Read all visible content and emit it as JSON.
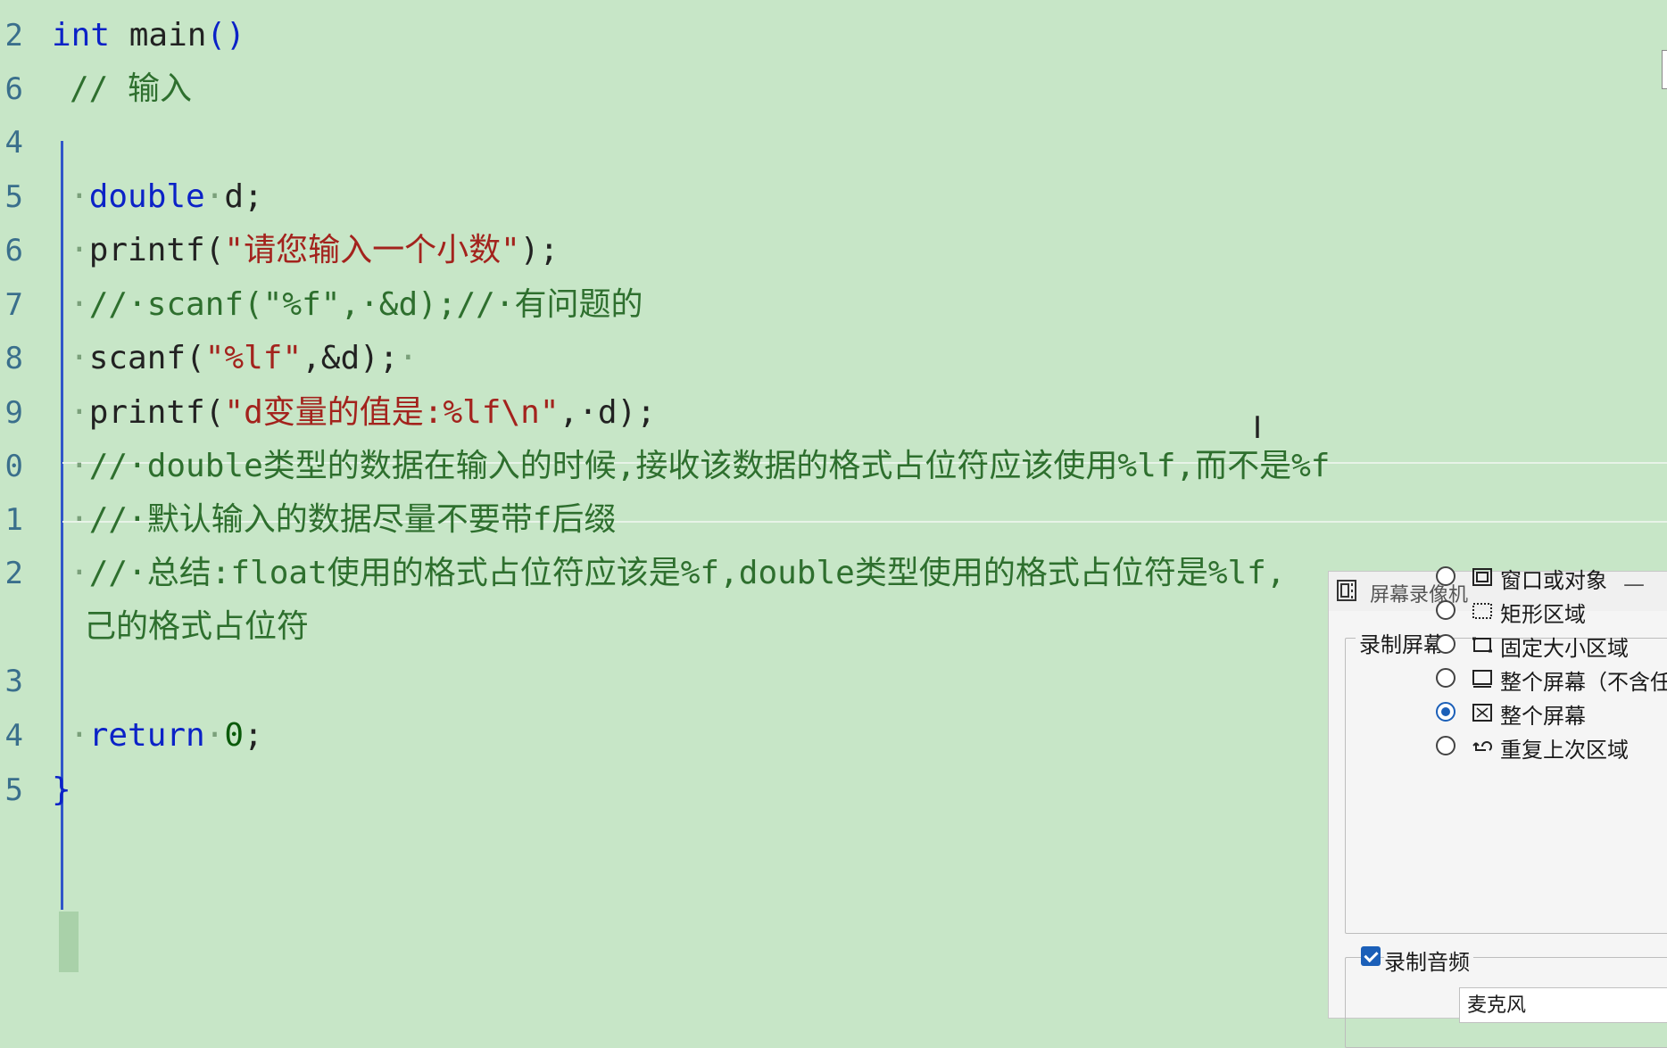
{
  "editor": {
    "lines": [
      {
        "no": "2",
        "segments": [
          [
            "kw",
            "int"
          ],
          [
            "punc",
            " "
          ],
          [
            "fn",
            "main"
          ],
          [
            "brace",
            "()"
          ]
        ],
        "indent": 0
      },
      {
        "no": "6",
        "segments": [
          [
            "cmt",
            "// 输入"
          ]
        ],
        "indent": 1
      },
      {
        "no": "4",
        "segments": [],
        "indent": 1
      },
      {
        "no": "5",
        "segments": [
          [
            "dot",
            "·"
          ],
          [
            "kw",
            "double"
          ],
          [
            "dot",
            "·"
          ],
          [
            "punc",
            "d;"
          ]
        ],
        "indent": 1
      },
      {
        "no": "6",
        "segments": [
          [
            "dot",
            "·"
          ],
          [
            "fn",
            "printf"
          ],
          [
            "punc",
            "("
          ],
          [
            "str",
            "\"请您输入一个小数\""
          ],
          [
            "punc",
            ");"
          ]
        ],
        "indent": 1
      },
      {
        "no": "7",
        "segments": [
          [
            "dot",
            "·"
          ],
          [
            "cmt",
            "//·scanf(\"%f\",·&d);//·有问题的"
          ]
        ],
        "indent": 1
      },
      {
        "no": "8",
        "segments": [
          [
            "dot",
            "·"
          ],
          [
            "fn",
            "scanf"
          ],
          [
            "punc",
            "("
          ],
          [
            "str",
            "\"%lf\""
          ],
          [
            "punc",
            ",&d);"
          ],
          [
            "dot",
            "·"
          ]
        ],
        "indent": 1
      },
      {
        "no": "9",
        "segments": [
          [
            "dot",
            "·"
          ],
          [
            "fn",
            "printf"
          ],
          [
            "punc",
            "("
          ],
          [
            "str",
            "\"d变量的值是:%lf\\n\""
          ],
          [
            "punc",
            ",·d);"
          ]
        ],
        "indent": 1
      },
      {
        "no": "0",
        "segments": [
          [
            "dot",
            "·"
          ],
          [
            "cmt",
            "//·double类型的数据在输入的时候,接收该数据的格式占位符应该使用%lf,而不是%f"
          ]
        ],
        "indent": 1
      },
      {
        "no": "1",
        "segments": [
          [
            "dot",
            "·"
          ],
          [
            "cmt",
            "//·默认输入的数据尽量不要带f后缀"
          ]
        ],
        "indent": 1
      },
      {
        "no": "2",
        "segments": [
          [
            "dot",
            "·"
          ],
          [
            "cmt",
            "//·总结:float使用的格式占位符应该是%f,double类型使用的格式占位符是%lf,"
          ]
        ],
        "indent": 1
      },
      {
        "no": "",
        "segments": [
          [
            "cmt",
            "己的格式占位符"
          ]
        ],
        "indent": 1
      },
      {
        "no": "3",
        "segments": [],
        "indent": 1
      },
      {
        "no": "4",
        "segments": [
          [
            "dot",
            "·"
          ],
          [
            "kw",
            "return"
          ],
          [
            "dot",
            "·"
          ],
          [
            "num",
            "0"
          ],
          [
            "punc",
            ";"
          ]
        ],
        "indent": 1
      },
      {
        "no": "5",
        "segments": [
          [
            "brace",
            "}"
          ]
        ],
        "indent": 0
      }
    ]
  },
  "recorder": {
    "title": "屏幕录像机",
    "minimize_glyph": "—",
    "screen_group_label": "录制屏幕",
    "options": [
      {
        "label": "窗口或对象",
        "selected": false,
        "icon": "window-icon"
      },
      {
        "label": "矩形区域",
        "selected": false,
        "icon": "dashed-rect-icon"
      },
      {
        "label": "固定大小区域",
        "selected": false,
        "icon": "fixed-rect-icon"
      },
      {
        "label": "整个屏幕（不含任",
        "selected": false,
        "icon": "monitor-icon"
      },
      {
        "label": "整个屏幕",
        "selected": true,
        "icon": "fullscreen-icon"
      },
      {
        "label": "重复上次区域",
        "selected": false,
        "icon": "repeat-icon"
      }
    ],
    "audio_label": "录制音频",
    "audio_checked": true,
    "audio_device": "麦克风"
  }
}
